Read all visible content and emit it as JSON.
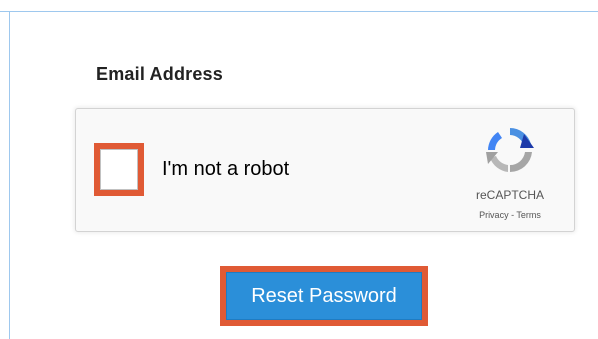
{
  "form": {
    "email_label": "Email Address"
  },
  "captcha": {
    "checkbox_checked": false,
    "label": "I'm not a robot",
    "brand": "reCAPTCHA",
    "privacy_link": "Privacy",
    "separator": " - ",
    "terms_link": "Terms",
    "logo_icon": "recaptcha-logo-icon"
  },
  "actions": {
    "reset_label": "Reset Password"
  },
  "colors": {
    "highlight": "#e05a35",
    "button_bg": "#2b8fd9",
    "frame": "#9ec8ee"
  }
}
